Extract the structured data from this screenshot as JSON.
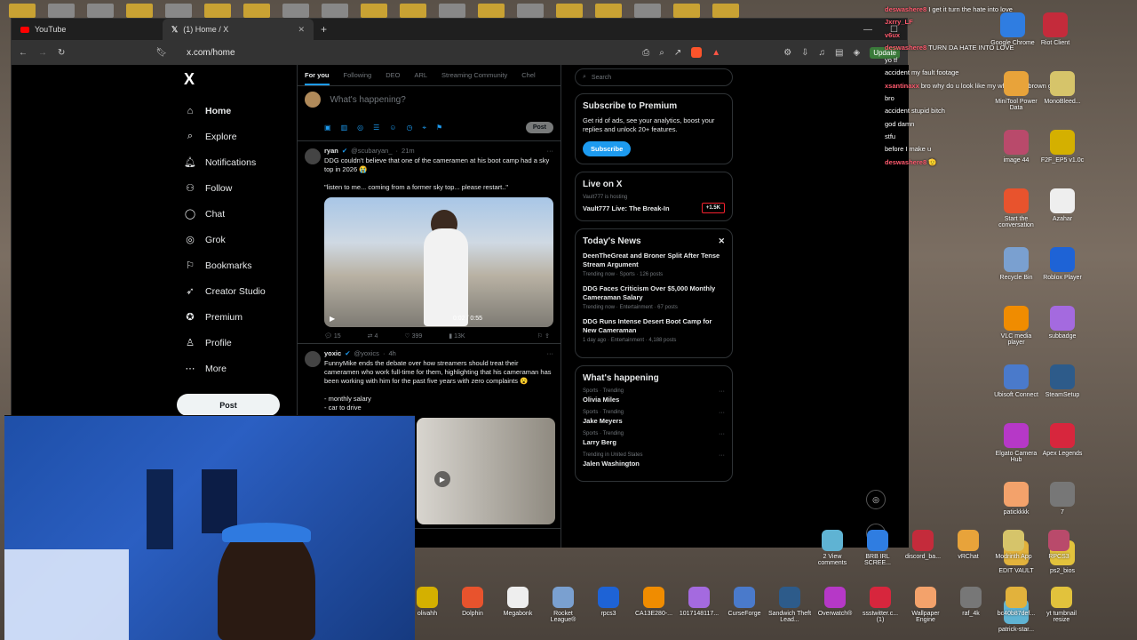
{
  "tabs": [
    {
      "label": "YouTube"
    },
    {
      "label": "(1) Home / X"
    }
  ],
  "address": {
    "url": "x.com/home",
    "update_label": "Update"
  },
  "nav": {
    "logo": "X",
    "items": [
      {
        "label": "Home",
        "icon": "home-icon"
      },
      {
        "label": "Explore",
        "icon": "search-icon"
      },
      {
        "label": "Notifications",
        "icon": "bell-icon"
      },
      {
        "label": "Follow",
        "icon": "follow-icon"
      },
      {
        "label": "Chat",
        "icon": "chat-icon"
      },
      {
        "label": "Grok",
        "icon": "grok-icon"
      },
      {
        "label": "Bookmarks",
        "icon": "bookmark-icon"
      },
      {
        "label": "Creator Studio",
        "icon": "rocket-icon"
      },
      {
        "label": "Premium",
        "icon": "premium-icon"
      },
      {
        "label": "Profile",
        "icon": "profile-icon"
      },
      {
        "label": "More",
        "icon": "more-icon"
      }
    ],
    "post_label": "Post"
  },
  "feed": {
    "tabs": [
      "For you",
      "Following",
      "DEO",
      "ARL",
      "Streaming Community",
      "Chel"
    ],
    "compose_placeholder": "What's happening?",
    "compose_post": "Post",
    "tweets": [
      {
        "name": "ryan",
        "handle": "@scubaryan_",
        "time": "21m",
        "text": "DDG couldn't believe that one of the cameramen at his boot camp had a sky top in 2026 😭\n\n\"listen to me... coming from a former sky top... please restart..\"",
        "video_time": "0:02 / 0:55",
        "replies": "15",
        "reposts": "4",
        "likes": "399",
        "views": "13K"
      },
      {
        "name": "yoxic",
        "handle": "@yoxics",
        "time": "4h",
        "text": "FunnyMike ends the debate over how streamers should treat their cameramen who work full-time for them, highlighting that his cameraman has been working with him for the past five years with zero complaints 😮\n\n- monthly salary\n- car to drive"
      }
    ]
  },
  "right": {
    "search_placeholder": "Search",
    "premium": {
      "title": "Subscribe to Premium",
      "text": "Get rid of ads, see your analytics, boost your replies and unlock 20+ features.",
      "button": "Subscribe"
    },
    "live": {
      "title": "Live on X",
      "host": "Vault777 is hosting",
      "stream": "Vault777 Live: The Break-In",
      "count": "+1.5K"
    },
    "news": {
      "title": "Today's News",
      "items": [
        {
          "t": "DeenTheGreat and Broner Split After Tense Stream Argument",
          "m": "Trending now · Sports · 126 posts"
        },
        {
          "t": "DDG Faces Criticism Over $5,000 Monthly Cameraman Salary",
          "m": "Trending now · Entertainment · 67 posts"
        },
        {
          "t": "DDG Runs Intense Desert Boot Camp for New Cameraman",
          "m": "1 day ago · Entertainment · 4,188 posts"
        }
      ]
    },
    "happening": {
      "title": "What's happening",
      "items": [
        {
          "c": "Sports · Trending",
          "n": "Olivia Miles"
        },
        {
          "c": "Sports · Trending",
          "n": "Jake Meyers"
        },
        {
          "c": "Sports · Trending",
          "n": "Larry Berg"
        },
        {
          "c": "Trending in United States",
          "n": "Jalen Washington"
        }
      ]
    }
  },
  "chat": [
    {
      "u": "deswashere8",
      "m": "I get it turn the hate into love"
    },
    {
      "u": "Jxrry_LF",
      "m": ""
    },
    {
      "u": "v6ux",
      "m": ""
    },
    {
      "u": "deswashere8",
      "m": "TURN DA HATE INTO LOVE"
    },
    {
      "u": "",
      "m": "yo tf"
    },
    {
      "u": "",
      "m": "accident my fault footage"
    },
    {
      "u": "xsantinaxx",
      "m": "bro why do u look like my white and brown gin pig"
    },
    {
      "u": "",
      "m": "bro"
    },
    {
      "u": "",
      "m": "accident stupid bitch"
    },
    {
      "u": "",
      "m": "god damn"
    },
    {
      "u": "",
      "m": "stfu"
    },
    {
      "u": "",
      "m": "before I make u"
    },
    {
      "u": "deswashere8",
      "m": "🫡"
    }
  ],
  "desktop": {
    "right": [
      "Google Chrome",
      "Riot Client",
      "MiniTool Power Data",
      "MonoBleed...",
      "image 44",
      "F2F_EP5 v1.0c",
      "Start the conversation",
      "Azahar",
      "Recycle Bin",
      "Roblox Player",
      "VLC media player",
      "subbadge",
      "Ubisoft Connect",
      "SteamSetup",
      "Elgato Camera Hub",
      "Apex Legends",
      "patickkkk",
      "7",
      "EDIT VAULT",
      "ps2_bios",
      "patrick-star..."
    ],
    "bottom": [
      "olivahh",
      "Dolphin",
      "Megabonk",
      "Rocket League®",
      "rpcs3",
      "CA13E280-...",
      "1017148117...",
      "CurseForge",
      "Sandwich Theft Lead...",
      "Overwatch®",
      "ssstwitter.c... (1)",
      "Wallpaper Engine",
      "raf_4k",
      "bc40b87def...",
      "yt tumbnail resize",
      "2 View comments",
      "BRB IRL SCREE...",
      "discord_ba...",
      "vRChat",
      "Modrinth App",
      "RPCS3"
    ]
  }
}
